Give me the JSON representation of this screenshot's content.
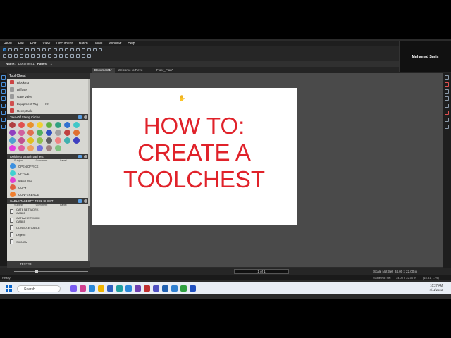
{
  "menu": [
    "Revu",
    "File",
    "Edit",
    "View",
    "Document",
    "Batch",
    "Tools",
    "Window",
    "Help"
  ],
  "propbar": {
    "name_label": "Name:",
    "name_value": "Document1",
    "pages_label": "Pages:",
    "pages_value": "1"
  },
  "tabs": [
    {
      "label": "Document1*",
      "active": true
    },
    {
      "label": "Welcome to Revu",
      "active": false
    },
    {
      "label": "Floor_Plan*",
      "active": false
    }
  ],
  "webcam_name": "Muhamad Saeis",
  "toolchest": {
    "title": "Tool Chest",
    "top_items": [
      {
        "label": "Blocking",
        "color": "#c94040"
      },
      {
        "label": "Diffuser",
        "color": "#9a9a9a"
      },
      {
        "label": "Gate Valve",
        "color": "#9a9a9a"
      },
      {
        "label": "Equipment Tag",
        "extra": "XX",
        "color": "#d05050"
      },
      {
        "label": "Receptacle",
        "color": "#c94040"
      }
    ],
    "section1": {
      "title": "Take-Off Stamp Circles"
    },
    "circle_colors": [
      "#b04040",
      "#e05050",
      "#e8902a",
      "#f0d030",
      "#60b040",
      "#30a080",
      "#3070d0",
      "#40c8c8",
      "#9040c0",
      "#d060a0",
      "#e07050",
      "#50b060",
      "#3050c0",
      "#a0a0a0",
      "#c04040",
      "#e07030",
      "#50a0d0",
      "#c05090",
      "#e0c020",
      "#90c050",
      "#606060",
      "#f08080",
      "#40b0b0",
      "#4040c0",
      "#e040e0",
      "#e060a0",
      "#f0a060",
      "#7070e0",
      "#a08080",
      "#80c080"
    ],
    "section2": {
      "title": "toolchest scratch pad test",
      "cols": [
        "Subject",
        "Comment",
        "Label"
      ]
    },
    "list_items": [
      {
        "label": "OPEN OFFICE",
        "color": "#3a8fe0"
      },
      {
        "label": "OFFICE",
        "color": "#40d0d0"
      },
      {
        "label": "MEETING",
        "color": "#e040d0"
      },
      {
        "label": "COPY",
        "color": "#e06040"
      },
      {
        "label": "CONFERENCE",
        "color": "#f08030"
      }
    ],
    "section3": {
      "title": "CABLE TAKEOFF TOOL CHEST",
      "cols": [
        "Subject",
        "Comment",
        "Label"
      ]
    },
    "cable_items": [
      {
        "label": "CAT6 NETWORK CABLE"
      },
      {
        "label": "CAT6a NETWORK CABLE"
      },
      {
        "label": "CONSOLE CABLE"
      },
      {
        "label": "Legend"
      },
      {
        "label": "SIGNCM"
      }
    ],
    "bottom_label": "TEST23"
  },
  "document": {
    "lines": [
      "HOW TO:",
      "CREATE A",
      "TOOLCHEST"
    ]
  },
  "bottombar": {
    "page_indicator": "1 of 1",
    "dims": "34.00 x 22.00 in",
    "scale": "Scale Not Set"
  },
  "statusbar": {
    "left": "Ready",
    "scale": "Scale Not Set",
    "dims": "34.00 x 22.00 in",
    "coords": "(15.51, 1.79)"
  },
  "taskbar": {
    "search_placeholder": "Search",
    "time": "10:37 AM",
    "date": "4/11/2023"
  }
}
